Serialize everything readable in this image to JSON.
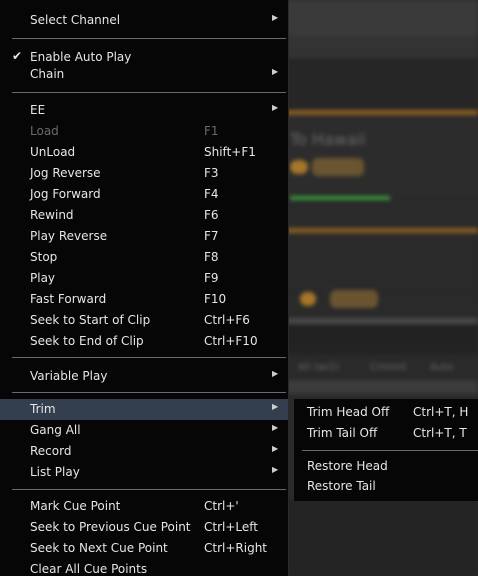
{
  "background": {
    "texts": [
      "To Hawaii",
      "All (w/2)",
      "Cmnmt",
      "Auto"
    ]
  },
  "menu": {
    "items": [
      {
        "label": "Select Channel",
        "shortcut": "",
        "submenu": true
      },
      {
        "label": "Enable Auto Play",
        "shortcut": "",
        "checked": true
      },
      {
        "label": "Chain",
        "shortcut": "",
        "submenu": true
      },
      {
        "label": "EE",
        "shortcut": "",
        "submenu": true
      },
      {
        "label": "Load",
        "shortcut": "F1",
        "disabled": true
      },
      {
        "label": "UnLoad",
        "shortcut": "Shift+F1"
      },
      {
        "label": "Jog Reverse",
        "shortcut": "F3"
      },
      {
        "label": "Jog Forward",
        "shortcut": "F4"
      },
      {
        "label": "Rewind",
        "shortcut": "F6"
      },
      {
        "label": "Play Reverse",
        "shortcut": "F7"
      },
      {
        "label": "Stop",
        "shortcut": "F8"
      },
      {
        "label": "Play",
        "shortcut": "F9"
      },
      {
        "label": "Fast Forward",
        "shortcut": "F10"
      },
      {
        "label": "Seek to Start of Clip",
        "shortcut": "Ctrl+F6"
      },
      {
        "label": "Seek to End of Clip",
        "shortcut": "Ctrl+F10"
      },
      {
        "label": "Variable Play",
        "shortcut": "",
        "submenu": true
      },
      {
        "label": "Trim",
        "shortcut": "",
        "submenu": true,
        "selected": true
      },
      {
        "label": "Gang All",
        "shortcut": "",
        "submenu": true
      },
      {
        "label": "Record",
        "shortcut": "",
        "submenu": true
      },
      {
        "label": "List Play",
        "shortcut": "",
        "submenu": true
      },
      {
        "label": "Mark Cue Point",
        "shortcut": "Ctrl+'"
      },
      {
        "label": "Seek to Previous Cue Point",
        "shortcut": "Ctrl+Left"
      },
      {
        "label": "Seek to Next Cue Point",
        "shortcut": "Ctrl+Right"
      },
      {
        "label": "Clear All Cue Points",
        "shortcut": ""
      }
    ]
  },
  "submenu": {
    "items": [
      {
        "label": "Trim Head Off",
        "shortcut": "Ctrl+T, H"
      },
      {
        "label": "Trim Tail Off",
        "shortcut": "Ctrl+T, T"
      },
      {
        "label": "Restore Head",
        "shortcut": ""
      },
      {
        "label": "Restore Tail",
        "shortcut": ""
      }
    ]
  },
  "colors": {
    "menu_bg": "#060606",
    "selected_bg": "#333f4e",
    "disabled_text": "#6b6b6b",
    "text": "#e6e6e6",
    "accent_orange": "#a7762a",
    "accent_green": "#3a9a3a"
  }
}
